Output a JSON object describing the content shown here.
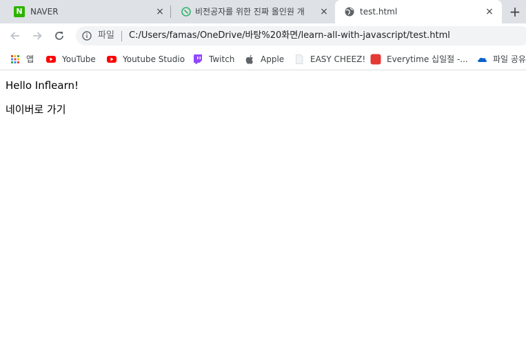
{
  "tabs": [
    {
      "title": "NAVER",
      "icon": "naver-icon",
      "favicon_text": "N",
      "close": "×"
    },
    {
      "title": "비전공자를 위한 진짜 올인원 개",
      "icon": "inflearn-icon",
      "close": "×"
    },
    {
      "title": "test.html",
      "icon": "globe-icon",
      "close": "×",
      "active": true
    }
  ],
  "new_tab": "+",
  "toolbar": {
    "omnibox_scheme": "파일",
    "url": "C:/Users/famas/OneDrive/바탕%20화면/learn-all-with-javascript/test.html"
  },
  "bookmarks": [
    {
      "label": "앱",
      "icon": "apps-grid-icon"
    },
    {
      "label": "YouTube",
      "icon": "youtube-icon"
    },
    {
      "label": "Youtube Studio",
      "icon": "youtube-icon"
    },
    {
      "label": "Twitch",
      "icon": "twitch-icon"
    },
    {
      "label": "Apple",
      "icon": "apple-icon"
    },
    {
      "label": "EASY CHEEZ!",
      "icon": "page-icon"
    },
    {
      "label": "Everytime 십일절 -...",
      "icon": "everytime-icon",
      "icon_text": "11D"
    },
    {
      "label": "파일 공유",
      "icon": "onedrive-icon"
    }
  ],
  "content": {
    "paragraph_1": "Hello Inflearn!",
    "link_text": "네이버로 가기"
  },
  "colors": {
    "tab_strip": "#dee1e6",
    "omnibox": "#f1f3f4",
    "naver_green": "#2db400",
    "youtube_red": "#ff0000",
    "twitch_purple": "#9146ff",
    "everytime_red": "#e53935",
    "onedrive_blue": "#0a63c9"
  }
}
